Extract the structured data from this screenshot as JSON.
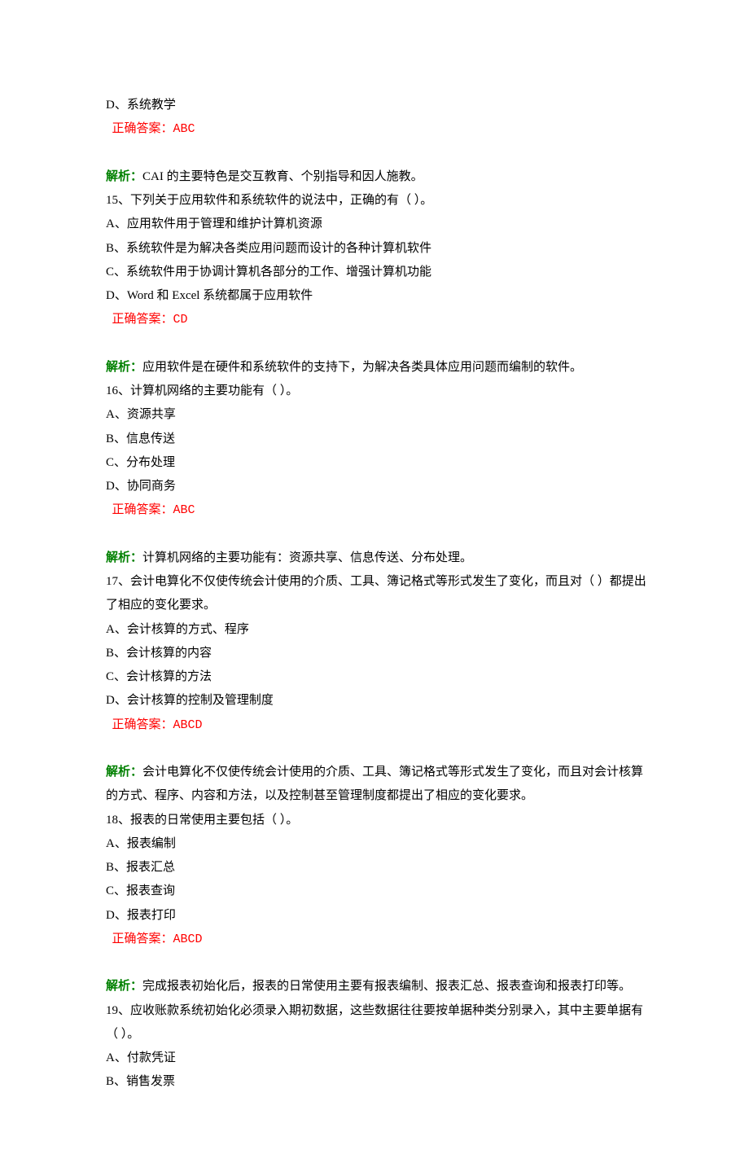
{
  "labels": {
    "correct_answer": "正确答案：",
    "analysis": "解析："
  },
  "content": [
    {
      "type": "text",
      "text": "D、系统教学"
    },
    {
      "type": "answer",
      "value": "ABC"
    },
    {
      "type": "gap"
    },
    {
      "type": "analysis",
      "text": "CAI 的主要特色是交互教育、个别指导和因人施教。"
    },
    {
      "type": "text",
      "text": "15、下列关于应用软件和系统软件的说法中，正确的有（ ）。"
    },
    {
      "type": "text",
      "text": "A、应用软件用于管理和维护计算机资源"
    },
    {
      "type": "text",
      "text": "B、系统软件是为解决各类应用问题而设计的各种计算机软件"
    },
    {
      "type": "text",
      "text": "C、系统软件用于协调计算机各部分的工作、增强计算机功能"
    },
    {
      "type": "text",
      "text": "D、Word 和 Excel 系统都属于应用软件"
    },
    {
      "type": "answer",
      "value": "CD"
    },
    {
      "type": "gap"
    },
    {
      "type": "analysis",
      "text": "应用软件是在硬件和系统软件的支持下，为解决各类具体应用问题而编制的软件。"
    },
    {
      "type": "text",
      "text": "16、计算机网络的主要功能有（ ）。"
    },
    {
      "type": "text",
      "text": "A、资源共享"
    },
    {
      "type": "text",
      "text": "B、信息传送"
    },
    {
      "type": "text",
      "text": "C、分布处理"
    },
    {
      "type": "text",
      "text": "D、协同商务"
    },
    {
      "type": "answer",
      "value": "ABC"
    },
    {
      "type": "gap"
    },
    {
      "type": "analysis",
      "text": "计算机网络的主要功能有：资源共享、信息传送、分布处理。"
    },
    {
      "type": "text",
      "text": "17、会计电算化不仅使传统会计使用的介质、工具、簿记格式等形式发生了变化，而且对（ ）都提出了相应的变化要求。"
    },
    {
      "type": "text",
      "text": "A、会计核算的方式、程序"
    },
    {
      "type": "text",
      "text": "B、会计核算的内容"
    },
    {
      "type": "text",
      "text": "C、会计核算的方法"
    },
    {
      "type": "text",
      "text": "D、会计核算的控制及管理制度"
    },
    {
      "type": "answer",
      "value": "ABCD"
    },
    {
      "type": "gap"
    },
    {
      "type": "analysis",
      "text": "会计电算化不仅使传统会计使用的介质、工具、簿记格式等形式发生了变化，而且对会计核算的方式、程序、内容和方法，以及控制甚至管理制度都提出了相应的变化要求。"
    },
    {
      "type": "text",
      "text": "18、报表的日常使用主要包括（ ）。"
    },
    {
      "type": "text",
      "text": "A、报表编制"
    },
    {
      "type": "text",
      "text": "B、报表汇总"
    },
    {
      "type": "text",
      "text": "C、报表查询"
    },
    {
      "type": "text",
      "text": "D、报表打印"
    },
    {
      "type": "answer",
      "value": "ABCD"
    },
    {
      "type": "gap"
    },
    {
      "type": "analysis",
      "text": "完成报表初始化后，报表的日常使用主要有报表编制、报表汇总、报表查询和报表打印等。"
    },
    {
      "type": "text",
      "text": "19、应收账款系统初始化必须录入期初数据，这些数据往往要按单据种类分别录入，其中主要单据有（ ）。"
    },
    {
      "type": "text",
      "text": "A、付款凭证"
    },
    {
      "type": "text",
      "text": "B、销售发票"
    }
  ]
}
